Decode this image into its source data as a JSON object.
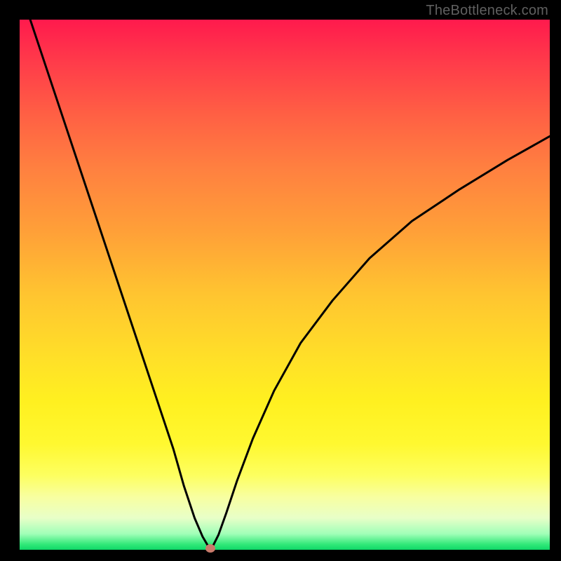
{
  "watermark": "TheBottleneck.com",
  "chart_data": {
    "type": "line",
    "title": "",
    "xlabel": "",
    "ylabel": "",
    "xlim": [
      0,
      100
    ],
    "ylim": [
      0,
      100
    ],
    "background_gradient": {
      "top": "#ff1a4d",
      "bottom": "#10d868",
      "stops": [
        "red",
        "orange",
        "yellow",
        "green"
      ]
    },
    "series": [
      {
        "name": "bottleneck-curve",
        "color": "#000000",
        "x": [
          2,
          5,
          8,
          11,
          14,
          17,
          20,
          23,
          26,
          29,
          31,
          33,
          34.5,
          35.5,
          36,
          36.5,
          37.5,
          39,
          41,
          44,
          48,
          53,
          59,
          66,
          74,
          83,
          92,
          100
        ],
        "y": [
          100,
          91,
          82,
          73,
          64,
          55,
          46,
          37,
          28,
          19,
          12,
          6,
          2.5,
          0.8,
          0.3,
          0.8,
          2.8,
          7,
          13,
          21,
          30,
          39,
          47,
          55,
          62,
          68,
          73.5,
          78
        ]
      }
    ],
    "marker": {
      "name": "optimal-point",
      "x": 36,
      "y": 0.3,
      "color": "#c97a6b"
    }
  }
}
